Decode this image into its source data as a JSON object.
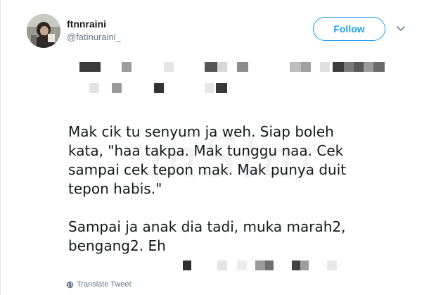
{
  "author": {
    "display_name": "ftnnraini",
    "username": "@fatinuraini_"
  },
  "header": {
    "follow_label": "Follow"
  },
  "tweet": {
    "paragraph_1": [
      "Mak cik tu senyum ja weh. Siap boleh",
      "kata, \"haa takpa. Mak tunggu naa. Cek",
      "sampai cek tepon mak. Mak punya duit",
      "tepon habis.\""
    ],
    "paragraph_2": [
      "Sampai ja anak dia tadi, muka marah2,",
      "bengang2. Eh"
    ]
  },
  "watermark": "mStar",
  "footer": {
    "translate_label": "Translate Tweet"
  },
  "icons": {
    "caret": "chevron-down-icon",
    "translate": "globe-icon"
  },
  "colors": {
    "accent": "#1da1f2",
    "text": "#14171a",
    "secondary": "#657786"
  }
}
